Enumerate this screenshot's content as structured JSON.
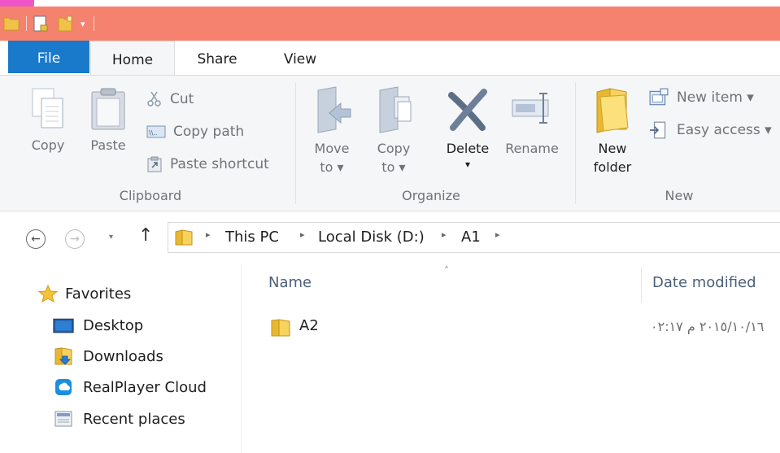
{
  "titlebar": {
    "color": "#f4826f",
    "qat_icons": [
      "folder-icon",
      "properties-icon",
      "new-folder-icon",
      "customize-qat-arrow-icon"
    ]
  },
  "tabs": [
    {
      "label": "File"
    },
    {
      "label": "Home"
    },
    {
      "label": "Share"
    },
    {
      "label": "View"
    }
  ],
  "ribbon": {
    "clipboard": {
      "copy": "Copy",
      "paste": "Paste",
      "cut": "Cut",
      "copy_path": "Copy path",
      "paste_shortcut": "Paste shortcut",
      "group": "Clipboard"
    },
    "organize": {
      "move_to": [
        "Move",
        "to ▾"
      ],
      "copy_to": [
        "Copy",
        "to ▾"
      ],
      "delete": "Delete",
      "delete_arrow": "▾",
      "rename": "Rename",
      "group": "Organize"
    },
    "new": {
      "new_folder": [
        "New",
        "folder"
      ],
      "new_item": "New item ▾",
      "easy_access": "Easy access ▾",
      "group": "New"
    }
  },
  "address": {
    "back": "←",
    "forward": "→",
    "recent": "▾",
    "up": "↑",
    "separator": "▸",
    "crumbs": [
      "This PC",
      "Local Disk (D:)",
      "A1"
    ]
  },
  "navigation": {
    "favorites": "Favorites",
    "items": [
      "Desktop",
      "Downloads",
      "RealPlayer Cloud",
      "Recent places"
    ]
  },
  "filelist": {
    "sort_indicator": "˄",
    "columns": {
      "name": "Name",
      "date_modified": "Date modified"
    },
    "rows": [
      {
        "name": "A2",
        "date": "٢٠١٥/١٠/١٦ م ٠٢:١٧"
      }
    ]
  }
}
